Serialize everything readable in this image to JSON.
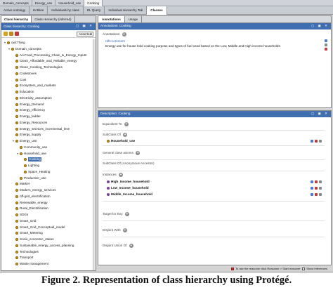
{
  "path_tabs": [
    "Active ontology",
    "Entities",
    "Individuals by class",
    "DL Query",
    "Individual Hierarchy Tab",
    "Classes"
  ],
  "top_path": [
    "Domain_concepts",
    "Energy_use",
    "Household_use",
    "Cooking"
  ],
  "left_tabs": [
    "Class hierarchy",
    "Class Hierarchy (inferred)"
  ],
  "class_hierarchy": {
    "header": "Class hierarchy: Cooking",
    "mode": "Asserted",
    "tree": [
      {
        "label": "owl:Thing",
        "depth": 0,
        "expanded": true
      },
      {
        "label": "Domain_concepts",
        "depth": 1,
        "expanded": true
      },
      {
        "label": "Ari-Food_Processing_Chain_&_Energy_Inputs",
        "depth": 2
      },
      {
        "label": "Clean_Affordable_and_Reliable_energy",
        "depth": 2
      },
      {
        "label": "Clean_Cooking_Technologies",
        "depth": 2
      },
      {
        "label": "Cookstoves",
        "depth": 2
      },
      {
        "label": "Cost",
        "depth": 2
      },
      {
        "label": "Ecosystem_and_markets",
        "depth": 2
      },
      {
        "label": "Education",
        "depth": 2
      },
      {
        "label": "Electricity_assumption",
        "depth": 2
      },
      {
        "label": "Energy_Demand",
        "depth": 2
      },
      {
        "label": "Energy_efficiency",
        "depth": 2
      },
      {
        "label": "Energy_ladder",
        "depth": 2
      },
      {
        "label": "Energy_Resources",
        "depth": 2
      },
      {
        "label": "Energy_services_incremental_leve",
        "depth": 2
      },
      {
        "label": "Energy_supply",
        "depth": 2
      },
      {
        "label": "Energy_use",
        "depth": 2,
        "expanded": true
      },
      {
        "label": "Community_use",
        "depth": 3
      },
      {
        "label": "Household_use",
        "depth": 3,
        "expanded": true
      },
      {
        "label": "Cooking",
        "depth": 4,
        "selected": true
      },
      {
        "label": "Lighting",
        "depth": 4
      },
      {
        "label": "Space_Heating",
        "depth": 4
      },
      {
        "label": "Productive_use",
        "depth": 3
      },
      {
        "label": "Market",
        "depth": 2
      },
      {
        "label": "Modern_energy_services",
        "depth": 2
      },
      {
        "label": "off-grid_electrification",
        "depth": 2
      },
      {
        "label": "Renewable_energy",
        "depth": 2
      },
      {
        "label": "Rural_Electrification",
        "depth": 2
      },
      {
        "label": "SDGs",
        "depth": 2
      },
      {
        "label": "Smart_Grid",
        "depth": 2
      },
      {
        "label": "Smart_Grid_Conceptual_model",
        "depth": 2
      },
      {
        "label": "Smart_Metering",
        "depth": 2
      },
      {
        "label": "Socio_economic_status",
        "depth": 2
      },
      {
        "label": "Sustainable_energy_access_planning",
        "depth": 2
      },
      {
        "label": "Technologies",
        "depth": 2
      },
      {
        "label": "Transport",
        "depth": 2
      },
      {
        "label": "Waste management",
        "depth": 2
      }
    ]
  },
  "right_tabs": [
    "Annotations",
    "Usage"
  ],
  "annotations": {
    "header": "Annotations: Cooking",
    "section_label": "Annotations",
    "property": "rdfs:comment",
    "value": "Energy use for house hold cooking purpose and types of fuel used based on the Low, Middle and High income households"
  },
  "description": {
    "header": "Description: Cooking",
    "equivalent_to": "Equivalent To",
    "subclass_of": "SubClass Of",
    "subclass_value": "Household_use",
    "general_class_axioms": "General class axioms",
    "subclass_anon": "SubClass Of (Anonymous Ancestor)",
    "instances": "Instances",
    "instance_values": [
      "High_Income_household",
      "Low_Income_household",
      "Middle_Income_household"
    ],
    "target_for_key": "Target for Key",
    "disjoint_with": "Disjoint With",
    "disjoint_union_of": "Disjoint Union Of"
  },
  "status": {
    "reasoner_text": "To use the reasoner click Reasoner > Start reasoner",
    "show_inferences": "Show Inferences"
  },
  "caption": "Figure 2. Representation of class hierarchy using Protégé.",
  "colors": {
    "header_blue": "#3f6fb0",
    "class_dot": "#d9a21c",
    "individual_dot": "#7b3fa0"
  }
}
